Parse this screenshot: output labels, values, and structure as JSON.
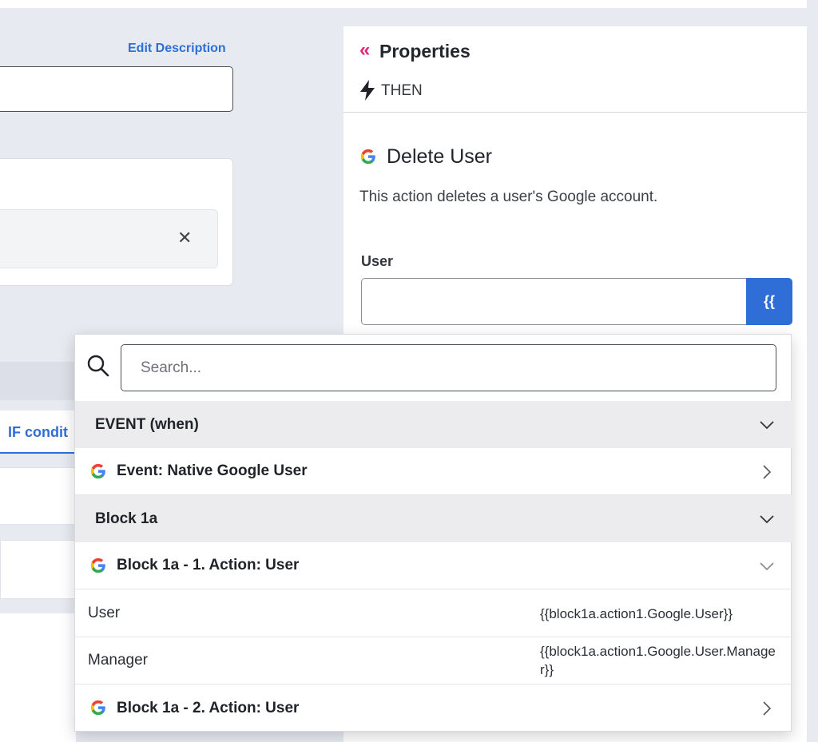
{
  "canvas": {
    "edit_description": "Edit Description",
    "if_tab_label": "IF condit"
  },
  "properties": {
    "title": "Properties",
    "then_label": "THEN",
    "action_title": "Delete User",
    "action_description": "This action deletes a user's Google account.",
    "user_field_label": "User",
    "user_field_value": "",
    "variable_button": "{{"
  },
  "picker": {
    "search_placeholder": "Search...",
    "rows": [
      {
        "type": "section",
        "label": "EVENT (when)",
        "chevron": "down"
      },
      {
        "type": "item",
        "icon": "google-icon",
        "label": "Event: Native Google User",
        "chevron": "right"
      },
      {
        "type": "section",
        "label": "Block 1a",
        "chevron": "down"
      },
      {
        "type": "item",
        "icon": "google-icon",
        "label": "Block 1a - 1. Action: User",
        "chevron": "down"
      },
      {
        "type": "field",
        "key": "User",
        "value": "{{block1a.action1.Google.User}}"
      },
      {
        "type": "field",
        "key": "Manager",
        "value": "{{block1a.action1.Google.User.Manager}}"
      },
      {
        "type": "item",
        "icon": "google-icon",
        "label": "Block 1a - 2. Action: User",
        "chevron": "right"
      }
    ]
  },
  "colors": {
    "accent_blue": "#2f6ed6",
    "collapse_pink": "#e0247a",
    "section_bg": "#ececee",
    "canvas_bg": "#e8eaf2"
  }
}
